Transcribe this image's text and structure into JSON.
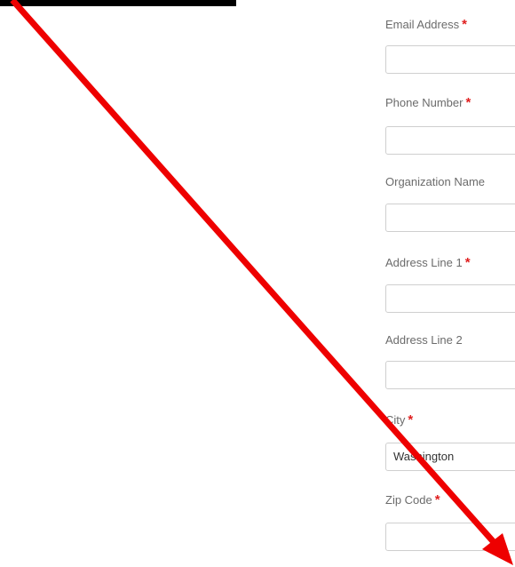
{
  "form": {
    "fields": [
      {
        "label": "Email Address",
        "required": "*",
        "value": ""
      },
      {
        "label": "Phone Number",
        "required": "*",
        "value": ""
      },
      {
        "label": "Organization Name",
        "required": "",
        "value": ""
      },
      {
        "label": "Address Line 1",
        "required": "*",
        "value": ""
      },
      {
        "label": "Address Line 2",
        "required": "",
        "value": ""
      },
      {
        "label": "City",
        "required": "*",
        "value": "Washington"
      },
      {
        "label": "Zip Code",
        "required": "*",
        "value": ""
      }
    ]
  },
  "annotation": {
    "arrow_color": "#ee0000"
  },
  "colors": {
    "required_marker": "#e02020",
    "label": "#6b6b6b",
    "input_border": "#cfcfcf"
  }
}
